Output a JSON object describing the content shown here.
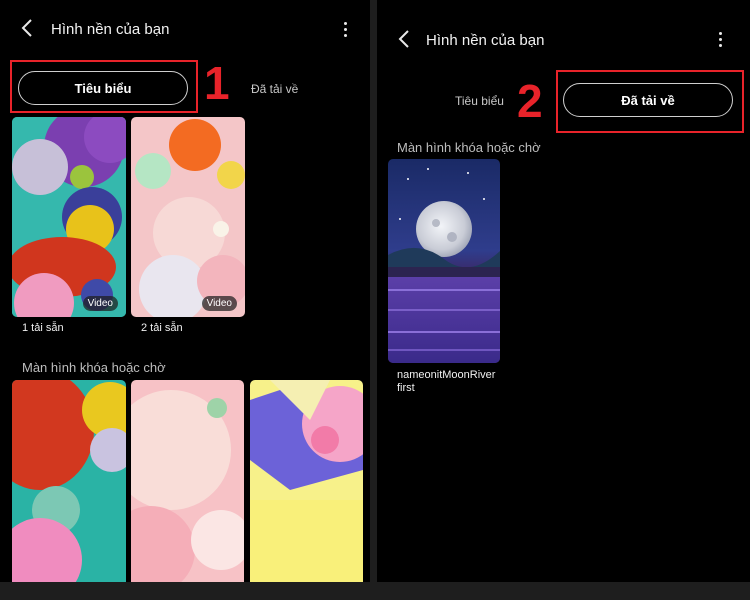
{
  "left_screen": {
    "title": "Hình nền của bạn",
    "tabs": {
      "featured": "Tiêu biểu",
      "downloaded": "Đã tải về"
    },
    "step_number": "1",
    "featured_items": [
      {
        "caption": "1 tải sẵn",
        "badge": "Video"
      },
      {
        "caption": "2 tải sẵn",
        "badge": "Video"
      }
    ],
    "section_title": "Màn hình khóa hoặc chờ"
  },
  "right_screen": {
    "title": "Hình nền của bạn",
    "tabs": {
      "featured": "Tiêu biểu",
      "downloaded": "Đã tải về"
    },
    "step_number": "2",
    "section_title": "Màn hình khóa hoặc chờ",
    "downloaded_items": [
      {
        "name": "nameonitMoonRiverfirst"
      }
    ]
  },
  "colors": {
    "highlight": "#e8232a",
    "background": "#000000",
    "outer": "#1e1e1e"
  },
  "icons": [
    "back-arrow-icon",
    "more-vertical-icon"
  ]
}
